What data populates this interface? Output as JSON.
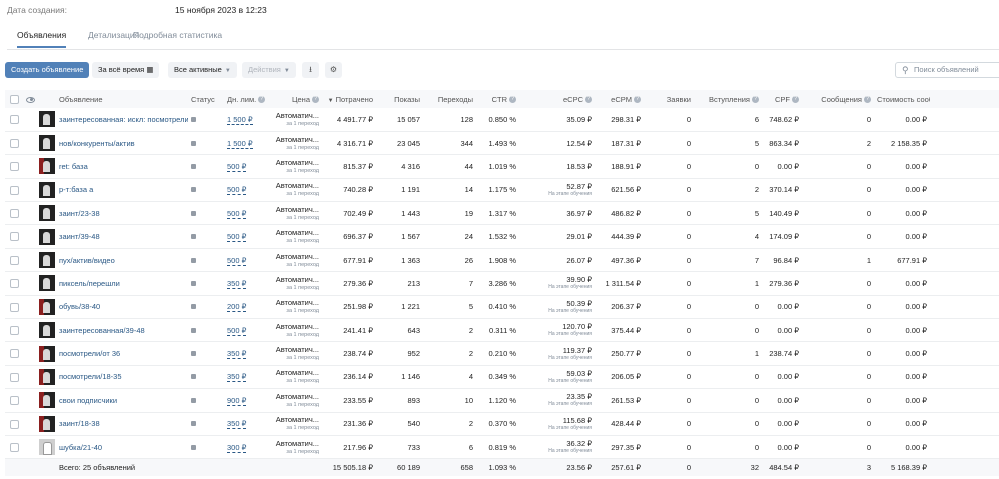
{
  "meta": {
    "created_label": "Дата создания:",
    "created_value": "15 ноября 2023 в 12:23"
  },
  "tabs": [
    "Объявления",
    "Детализация",
    "Подробная статистика"
  ],
  "toolbar": {
    "create_label": "Создать объявление",
    "period_label": "За всё время",
    "filter_label": "Все активные",
    "actions_label": "Действия",
    "search_placeholder": "Поиск объявлений"
  },
  "columns": {
    "ad": "Объявление",
    "status": "Статус",
    "limit": "Дн. лим.",
    "price": "Цена",
    "spent": "Потрачено",
    "shows": "Показы",
    "clicks": "Переходы",
    "ctr": "CTR",
    "ecpc": "eCPC",
    "ecpm": "eCPM",
    "leads": "Заявки",
    "joins": "Вступления",
    "cpf": "CPF",
    "messages": "Сообщения",
    "msg_cost": "Стоимость сообщения"
  },
  "price_main": "Автоматич...",
  "price_sub": "за 1 переход",
  "learning_note": "На этапе обучения",
  "rows": [
    {
      "name": "заинтересованная: искл: посмотрели",
      "limit": "1 500 ₽",
      "spent": "4 491.77 ₽",
      "shows": "15 057",
      "clicks": "128",
      "ctr": "0.850 %",
      "ecpc": "35.09 ₽",
      "ecpc_note": "",
      "ecpm": "298.31 ₽",
      "leads": "0",
      "joins": "6",
      "cpf": "748.62 ₽",
      "messages": "0",
      "msg_cost": "0.00 ₽",
      "thumb": "dark"
    },
    {
      "name": "нов/конкуренты/актив",
      "limit": "1 500 ₽",
      "spent": "4 316.71 ₽",
      "shows": "23 045",
      "clicks": "344",
      "ctr": "1.493 %",
      "ecpc": "12.54 ₽",
      "ecpc_note": "",
      "ecpm": "187.31 ₽",
      "leads": "0",
      "joins": "5",
      "cpf": "863.34 ₽",
      "messages": "2",
      "msg_cost": "2 158.35 ₽",
      "thumb": "dark"
    },
    {
      "name": "ret: база",
      "limit": "500 ₽",
      "spent": "815.37 ₽",
      "shows": "4 316",
      "clicks": "44",
      "ctr": "1.019 %",
      "ecpc": "18.53 ₽",
      "ecpc_note": "",
      "ecpm": "188.91 ₽",
      "leads": "0",
      "joins": "0",
      "cpf": "0.00 ₽",
      "messages": "0",
      "msg_cost": "0.00 ₽",
      "thumb": "red"
    },
    {
      "name": "р-т:база а",
      "limit": "500 ₽",
      "spent": "740.28 ₽",
      "shows": "1 191",
      "clicks": "14",
      "ctr": "1.175 %",
      "ecpc": "52.87 ₽",
      "ecpc_note": "На этапе обучения",
      "ecpm": "621.56 ₽",
      "leads": "0",
      "joins": "2",
      "cpf": "370.14 ₽",
      "messages": "0",
      "msg_cost": "0.00 ₽",
      "thumb": "dark"
    },
    {
      "name": "заинт/23-38",
      "limit": "500 ₽",
      "spent": "702.49 ₽",
      "shows": "1 443",
      "clicks": "19",
      "ctr": "1.317 %",
      "ecpc": "36.97 ₽",
      "ecpc_note": "",
      "ecpm": "486.82 ₽",
      "leads": "0",
      "joins": "5",
      "cpf": "140.49 ₽",
      "messages": "0",
      "msg_cost": "0.00 ₽",
      "thumb": "dark"
    },
    {
      "name": "заинт/39-48",
      "limit": "500 ₽",
      "spent": "696.37 ₽",
      "shows": "1 567",
      "clicks": "24",
      "ctr": "1.532 %",
      "ecpc": "29.01 ₽",
      "ecpc_note": "",
      "ecpm": "444.39 ₽",
      "leads": "0",
      "joins": "4",
      "cpf": "174.09 ₽",
      "messages": "0",
      "msg_cost": "0.00 ₽",
      "thumb": "dark"
    },
    {
      "name": "пух/актив/видео",
      "limit": "500 ₽",
      "spent": "677.91 ₽",
      "shows": "1 363",
      "clicks": "26",
      "ctr": "1.908 %",
      "ecpc": "26.07 ₽",
      "ecpc_note": "",
      "ecpm": "497.36 ₽",
      "leads": "0",
      "joins": "7",
      "cpf": "96.84 ₽",
      "messages": "1",
      "msg_cost": "677.91 ₽",
      "thumb": "dark"
    },
    {
      "name": "пиксель/перешли",
      "limit": "350 ₽",
      "spent": "279.36 ₽",
      "shows": "213",
      "clicks": "7",
      "ctr": "3.286 %",
      "ecpc": "39.90 ₽",
      "ecpc_note": "На этапе обучения",
      "ecpm": "1 311.54 ₽",
      "leads": "0",
      "joins": "1",
      "cpf": "279.36 ₽",
      "messages": "0",
      "msg_cost": "0.00 ₽",
      "thumb": "dark"
    },
    {
      "name": "обувь/38-40",
      "limit": "200 ₽",
      "spent": "251.98 ₽",
      "shows": "1 221",
      "clicks": "5",
      "ctr": "0.410 %",
      "ecpc": "50.39 ₽",
      "ecpc_note": "На этапе обучения",
      "ecpm": "206.37 ₽",
      "leads": "0",
      "joins": "0",
      "cpf": "0.00 ₽",
      "messages": "0",
      "msg_cost": "0.00 ₽",
      "thumb": "red"
    },
    {
      "name": "заинтересованная/39-48",
      "limit": "500 ₽",
      "spent": "241.41 ₽",
      "shows": "643",
      "clicks": "2",
      "ctr": "0.311 %",
      "ecpc": "120.70 ₽",
      "ecpc_note": "На этапе обучения",
      "ecpm": "375.44 ₽",
      "leads": "0",
      "joins": "0",
      "cpf": "0.00 ₽",
      "messages": "0",
      "msg_cost": "0.00 ₽",
      "thumb": "dark"
    },
    {
      "name": "посмотрели/от 36",
      "limit": "350 ₽",
      "spent": "238.74 ₽",
      "shows": "952",
      "clicks": "2",
      "ctr": "0.210 %",
      "ecpc": "119.37 ₽",
      "ecpc_note": "На этапе обучения",
      "ecpm": "250.77 ₽",
      "leads": "0",
      "joins": "1",
      "cpf": "238.74 ₽",
      "messages": "0",
      "msg_cost": "0.00 ₽",
      "thumb": "red"
    },
    {
      "name": "посмотрели/18-35",
      "limit": "350 ₽",
      "spent": "236.14 ₽",
      "shows": "1 146",
      "clicks": "4",
      "ctr": "0.349 %",
      "ecpc": "59.03 ₽",
      "ecpc_note": "На этапе обучения",
      "ecpm": "206.05 ₽",
      "leads": "0",
      "joins": "0",
      "cpf": "0.00 ₽",
      "messages": "0",
      "msg_cost": "0.00 ₽",
      "thumb": "red"
    },
    {
      "name": "свои подписчики",
      "limit": "900 ₽",
      "spent": "233.55 ₽",
      "shows": "893",
      "clicks": "10",
      "ctr": "1.120 %",
      "ecpc": "23.35 ₽",
      "ecpc_note": "На этапе обучения",
      "ecpm": "261.53 ₽",
      "leads": "0",
      "joins": "0",
      "cpf": "0.00 ₽",
      "messages": "0",
      "msg_cost": "0.00 ₽",
      "thumb": "red"
    },
    {
      "name": "заинт/18-38",
      "limit": "350 ₽",
      "spent": "231.36 ₽",
      "shows": "540",
      "clicks": "2",
      "ctr": "0.370 %",
      "ecpc": "115.68 ₽",
      "ecpc_note": "На этапе обучения",
      "ecpm": "428.44 ₽",
      "leads": "0",
      "joins": "0",
      "cpf": "0.00 ₽",
      "messages": "0",
      "msg_cost": "0.00 ₽",
      "thumb": "red"
    },
    {
      "name": "шубка/21-40",
      "limit": "300 ₽",
      "spent": "217.96 ₽",
      "shows": "733",
      "clicks": "6",
      "ctr": "0.819 %",
      "ecpc": "36.32 ₽",
      "ecpc_note": "На этапе обучения",
      "ecpm": "297.35 ₽",
      "leads": "0",
      "joins": "0",
      "cpf": "0.00 ₽",
      "messages": "0",
      "msg_cost": "0.00 ₽",
      "thumb": "light"
    }
  ],
  "totals": {
    "label": "Всего: 25 объявлений",
    "spent": "15 505.18 ₽",
    "shows": "60 189",
    "clicks": "658",
    "ctr": "1.093 %",
    "ecpc": "23.56 ₽",
    "ecpm": "257.61 ₽",
    "leads": "0",
    "joins": "32",
    "cpf": "484.54 ₽",
    "messages": "3",
    "msg_cost": "5 168.39 ₽"
  }
}
